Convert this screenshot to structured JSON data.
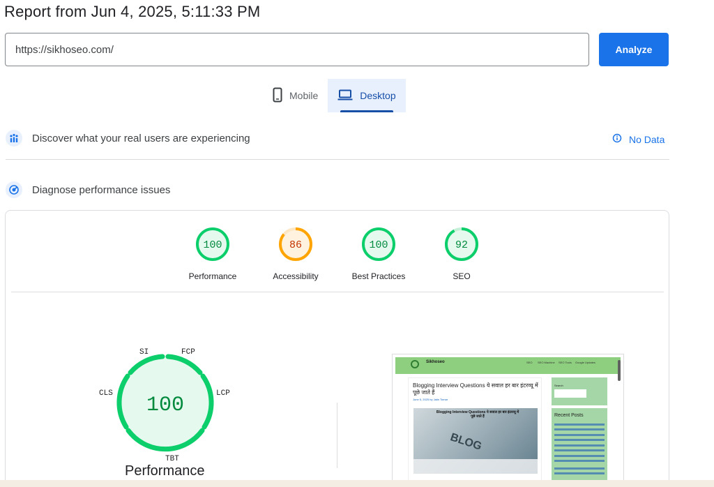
{
  "report": {
    "title": "Report from Jun 4, 2025, 5:11:33 PM"
  },
  "url_bar": {
    "value": "https://sikhoseo.com/",
    "analyze_label": "Analyze"
  },
  "device_tabs": [
    {
      "label": "Mobile",
      "icon": "phone-icon",
      "active": false
    },
    {
      "label": "Desktop",
      "icon": "laptop-icon",
      "active": true
    }
  ],
  "field_data": {
    "heading": "Discover what your real users are experiencing",
    "status": "No Data",
    "icon": "users-chart-icon"
  },
  "lab_data": {
    "heading": "Diagnose performance issues",
    "icon": "gauge-icon"
  },
  "scores": [
    {
      "label": "Performance",
      "value": 100,
      "color": "#0cce6b"
    },
    {
      "label": "Accessibility",
      "value": 86,
      "color": "#ffa400"
    },
    {
      "label": "Best Practices",
      "value": 100,
      "color": "#0cce6b"
    },
    {
      "label": "SEO",
      "value": 92,
      "color": "#0cce6b"
    }
  ],
  "performance_gauge": {
    "score": "100",
    "label": "Performance",
    "metrics": [
      "SI",
      "FCP",
      "LCP",
      "TBT",
      "CLS"
    ]
  },
  "screenshot": {
    "site_name": "Sikhoseo",
    "nav": [
      "SEO",
      "SEO Machine",
      "SEO Tools",
      "Google Updates"
    ],
    "post_title": "Blogging Interview Questions ये सवाल हर बार इंटरव्यू में पूछे जाते हैं",
    "post_meta": "June 5, 2025 by Jatin Tomar",
    "image_caption": "Blogging Interview Questions ये सवाल हर बार इंटरव्यू में पूछे जाते हैं",
    "image_word": "BLOG",
    "sidebar_search_label": "Search",
    "recent_posts_heading": "Recent Posts"
  }
}
